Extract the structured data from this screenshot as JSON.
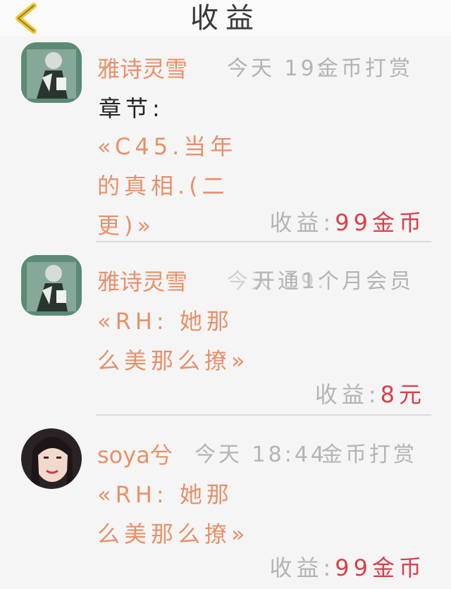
{
  "header": {
    "title": "收益"
  },
  "entries": [
    {
      "username": "雅诗灵雪",
      "meta": "今天 19:",
      "type": "金币打赏",
      "chapter_label": "章节:",
      "work": "«C45.当年的真相.(二更)»",
      "income_label": "收益:",
      "amount": "99金币"
    },
    {
      "username": "雅诗灵雪",
      "meta": "今天 19:",
      "type": "开通1个月会员",
      "work": "«RH: 她那么美那么撩»",
      "income_label": "收益:",
      "amount": "8元"
    },
    {
      "username": "soya兮",
      "meta": "今天 18:44",
      "type": "金币打赏",
      "work": "«RH: 她那么美那么撩»",
      "income_label": "收益:",
      "amount": "99金币"
    }
  ],
  "colors": {
    "username": "#e8906a",
    "work": "#e8906a",
    "amount": "#d8404a",
    "muted": "#b4b4b4",
    "back_icon": "#f0c830"
  },
  "icons": {
    "back": "chevron-left-icon"
  }
}
